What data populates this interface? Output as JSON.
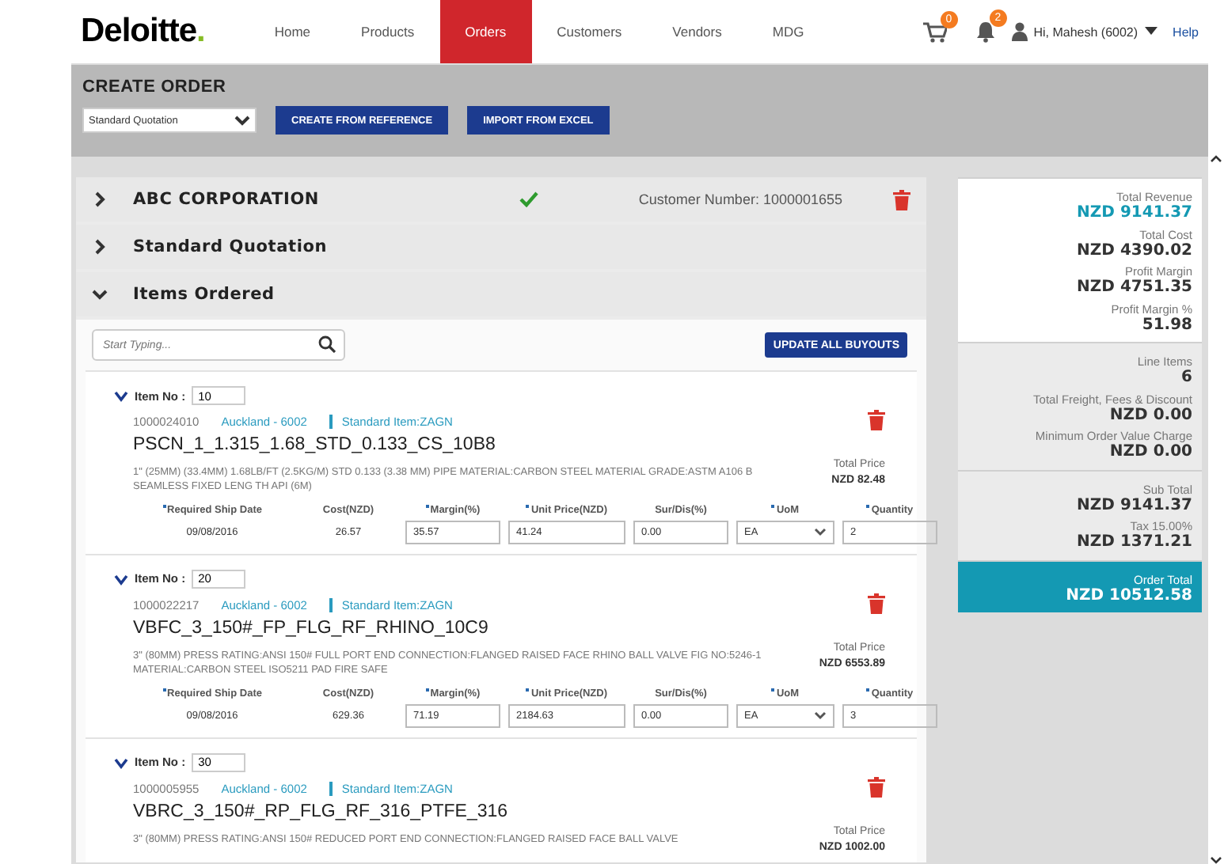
{
  "header": {
    "logo": "Deloitte",
    "logo_mark": ".",
    "nav": [
      {
        "label": "Home",
        "selected": false
      },
      {
        "label": "Products",
        "selected": false
      },
      {
        "label": "Orders",
        "selected": true
      },
      {
        "label": "Customers",
        "selected": false
      },
      {
        "label": "Vendors",
        "selected": false
      },
      {
        "label": "MDG",
        "selected": false
      }
    ],
    "cart_badge": "0",
    "bell_badge": "2",
    "user": "Hi, Mahesh (6002)",
    "help": "Help"
  },
  "toolbar": {
    "title": "CREATE ORDER",
    "order_type": "Standard Quotation",
    "buttons": [
      "CREATE FROM REFERENCE",
      "IMPORT FROM EXCEL"
    ]
  },
  "sections": [
    {
      "title": "ABC CORPORATION",
      "expanded": false,
      "verified": true,
      "customer_number": "Customer Number: 1000001655"
    },
    {
      "title": "Standard Quotation",
      "expanded": false,
      "verified": false
    },
    {
      "title": "Items Ordered",
      "expanded": true,
      "verified": false
    }
  ],
  "items_panel": {
    "search_placeholder": "Start Typing...",
    "update_button": "UPDATE ALL BUYOUTS",
    "items": [
      {
        "label": "Item No :",
        "item_no": "10",
        "code": "1000024010",
        "location": "Auckland - 6002",
        "item_type": "Standard Item:ZAGN",
        "name": "PSCN_1_1.315_1.68_STD_0.133_CS_10B8",
        "description": "1\" (25MM) (33.4MM) 1.68LB/FT (2.5KG/M) STD 0.133 (3.38 MM) PIPE MATERIAL:CARBON STEEL MATERIAL GRADE:ASTM A106 B SEAMLESS FIXED LENG TH API (6M)",
        "price_label": "Total Price",
        "price": "NZD 82.48",
        "fields": [
          {
            "label": "Required Ship Date",
            "required": true,
            "kind": "text",
            "value": "09/08/2016"
          },
          {
            "label": "Cost(NZD)",
            "required": false,
            "kind": "text",
            "value": "26.57"
          },
          {
            "label": "Margin(%)",
            "required": true,
            "kind": "input",
            "value": "35.57"
          },
          {
            "label": "Unit Price(NZD)",
            "required": true,
            "kind": "input",
            "value": "41.24"
          },
          {
            "label": "Sur/Dis(%)",
            "required": false,
            "kind": "input",
            "value": "0.00"
          },
          {
            "label": "UoM",
            "required": true,
            "kind": "select",
            "value": "EA"
          },
          {
            "label": "Quantity",
            "required": true,
            "kind": "input",
            "value": "2"
          }
        ]
      },
      {
        "label": "Item No :",
        "item_no": "20",
        "code": "1000022217",
        "location": "Auckland - 6002",
        "item_type": "Standard Item:ZAGN",
        "name": "VBFC_3_150#_FP_FLG_RF_RHINO_10C9",
        "description": "3\" (80MM) PRESS RATING:ANSI 150# FULL PORT END CONNECTION:FLANGED RAISED FACE RHINO BALL VALVE FIG NO:5246-1 MATERIAL:CARBON STEEL ISO5211 PAD FIRE SAFE",
        "price_label": "Total Price",
        "price": "NZD 6553.89",
        "fields": [
          {
            "label": "Required Ship Date",
            "required": true,
            "kind": "text",
            "value": "09/08/2016"
          },
          {
            "label": "Cost(NZD)",
            "required": false,
            "kind": "text",
            "value": "629.36"
          },
          {
            "label": "Margin(%)",
            "required": true,
            "kind": "input",
            "value": "71.19"
          },
          {
            "label": "Unit Price(NZD)",
            "required": true,
            "kind": "input",
            "value": "2184.63"
          },
          {
            "label": "Sur/Dis(%)",
            "required": false,
            "kind": "input",
            "value": "0.00"
          },
          {
            "label": "UoM",
            "required": true,
            "kind": "select",
            "value": "EA"
          },
          {
            "label": "Quantity",
            "required": true,
            "kind": "input",
            "value": "3"
          }
        ]
      },
      {
        "label": "Item No :",
        "item_no": "30",
        "code": "1000005955",
        "location": "Auckland - 6002",
        "item_type": "Standard Item:ZAGN",
        "name": "VBRC_3_150#_RP_FLG_RF_316_PTFE_316",
        "description": "3\" (80MM) PRESS RATING:ANSI 150# REDUCED PORT END CONNECTION:FLANGED RAISED FACE BALL VALVE",
        "price_label": "Total Price",
        "price": "NZD 1002.00"
      }
    ]
  },
  "summary": {
    "groups": [
      {
        "kind": "top",
        "rows": [
          {
            "label": "Total Revenue",
            "value": "NZD 9141.37",
            "accent": true
          },
          {
            "label": "Total Cost",
            "value": "NZD 4390.02",
            "accent": false
          },
          {
            "label": "Profit Margin",
            "value": "NZD 4751.35",
            "accent": false
          },
          {
            "label": "Profit Margin %",
            "value": "51.98",
            "accent": false
          }
        ]
      },
      {
        "kind": "mid",
        "rows": [
          {
            "label": "Line Items",
            "value": "6",
            "accent": false
          },
          {
            "label": "Total Freight, Fees & Discount",
            "value": "NZD 0.00",
            "accent": false
          },
          {
            "label": "Minimum Order Value Charge",
            "value": "NZD 0.00",
            "accent": false
          }
        ]
      },
      {
        "kind": "mid",
        "rows": [
          {
            "label": "Sub Total",
            "value": "NZD 9141.37",
            "accent": false
          },
          {
            "label": "Tax 15.00%",
            "value": "NZD 1371.21",
            "accent": false
          }
        ]
      },
      {
        "kind": "total",
        "rows": [
          {
            "label": "Order Total",
            "value": "NZD 10512.58"
          }
        ]
      }
    ]
  }
}
